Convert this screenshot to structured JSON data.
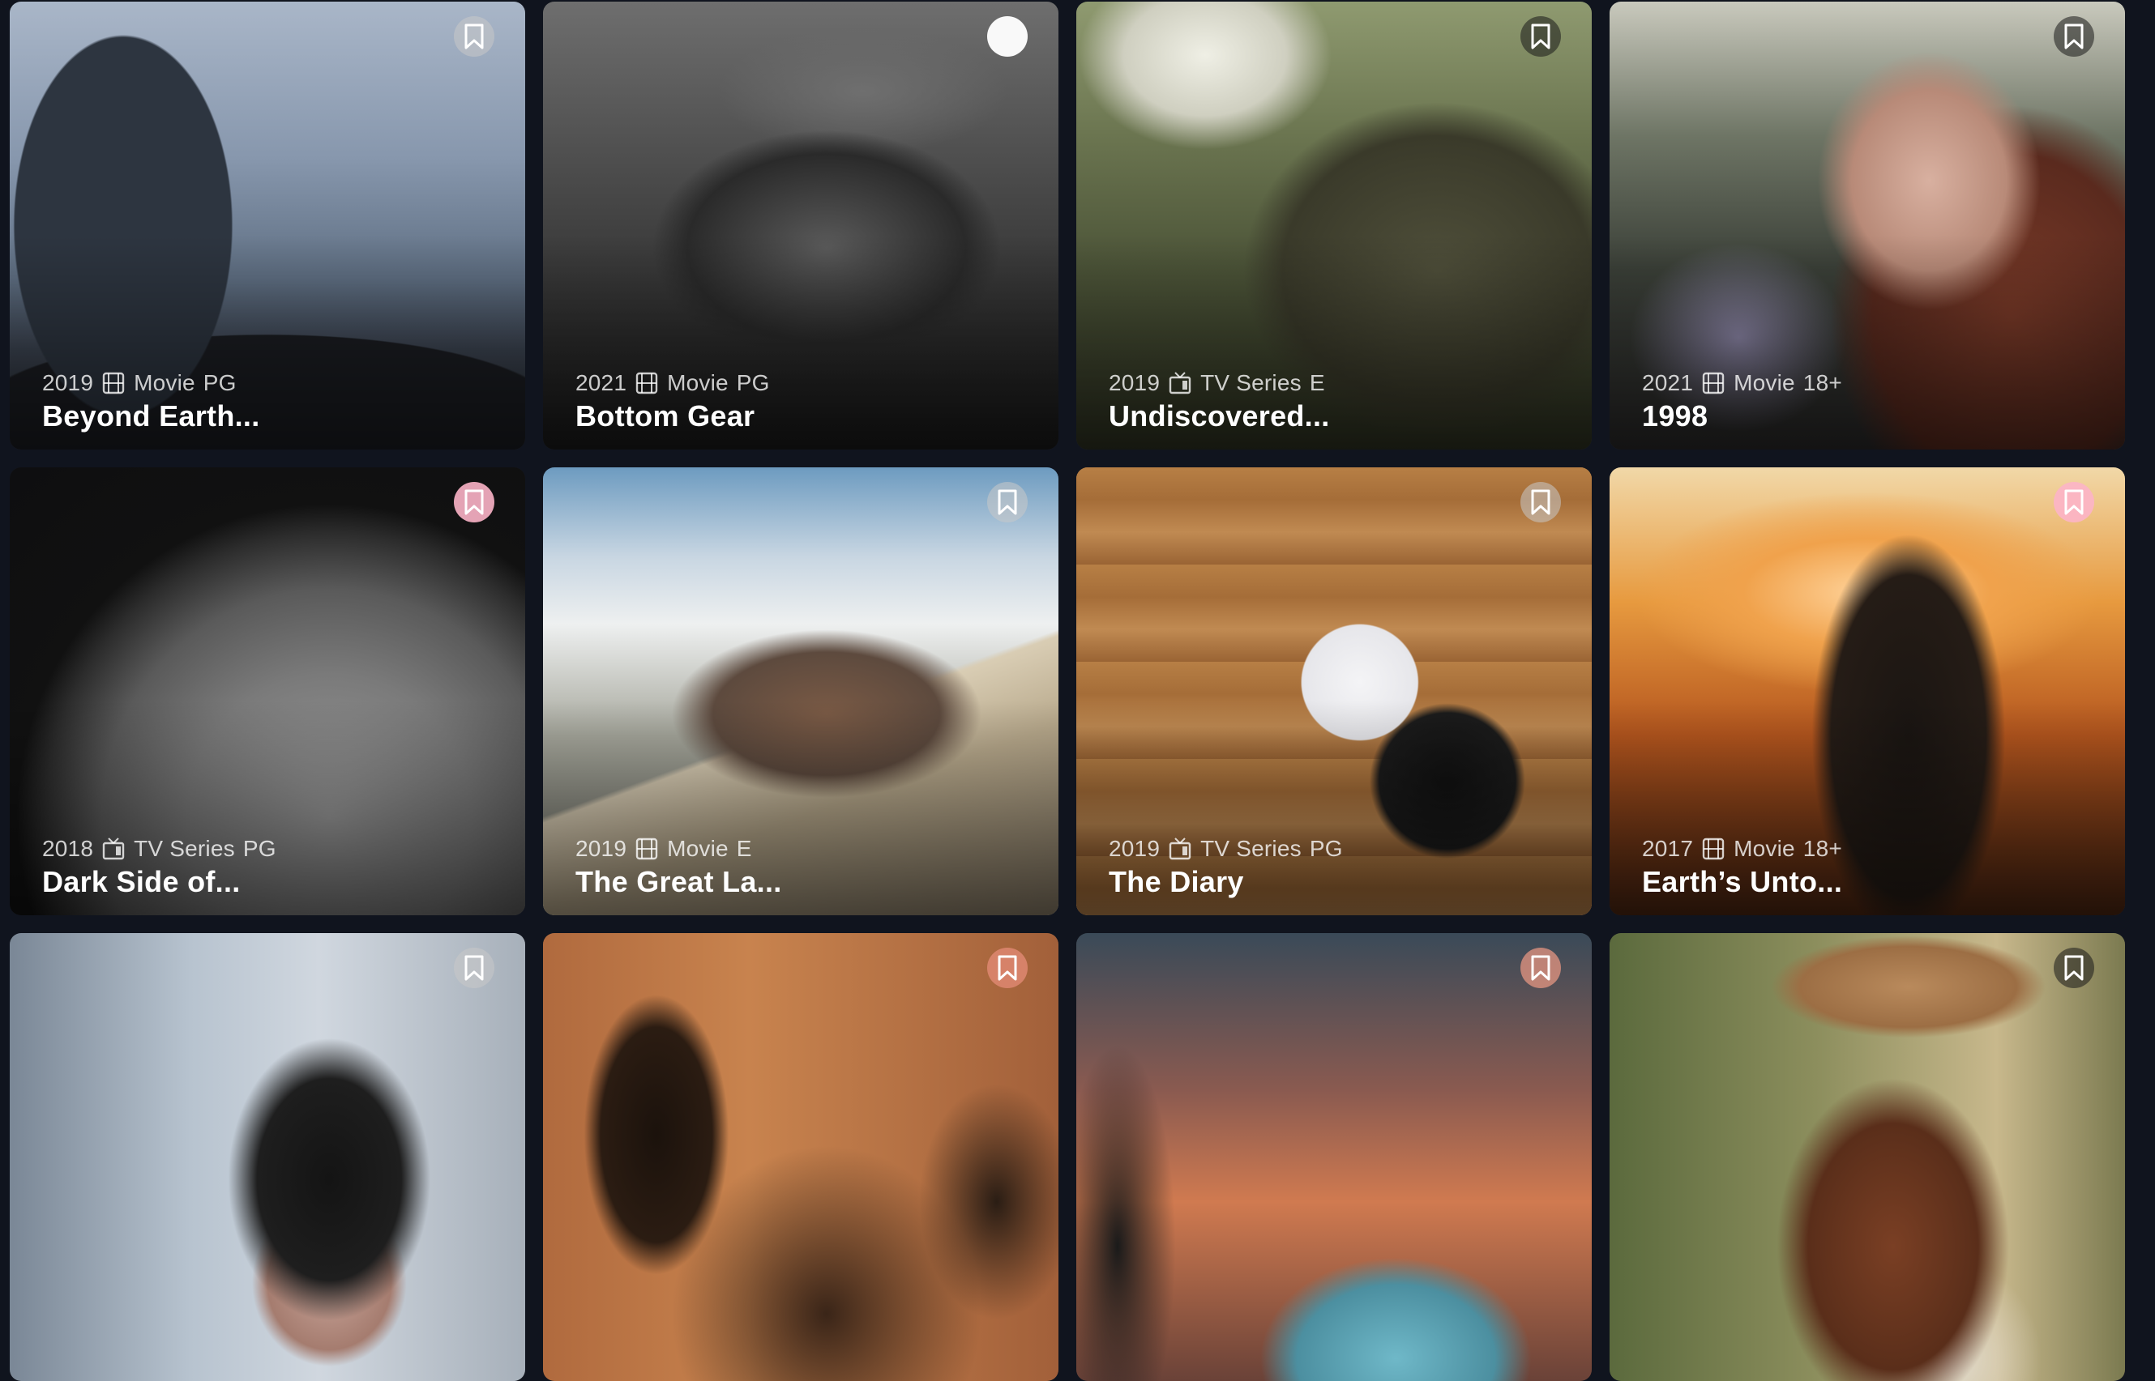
{
  "cards": [
    {
      "year": "2019",
      "category": "Movie",
      "rating": "PG",
      "title": "Beyond Earth...",
      "category_icon": "film-icon",
      "bookmark_style": "light"
    },
    {
      "year": "2021",
      "category": "Movie",
      "rating": "PG",
      "title": "Bottom Gear",
      "category_icon": "film-icon",
      "bookmark_style": "solid"
    },
    {
      "year": "2019",
      "category": "TV Series",
      "rating": "E",
      "title": "Undiscovered...",
      "category_icon": "tv-icon",
      "bookmark_style": "dark"
    },
    {
      "year": "2021",
      "category": "Movie",
      "rating": "18+",
      "title": "1998",
      "category_icon": "film-icon",
      "bookmark_style": "dark"
    },
    {
      "year": "2018",
      "category": "TV Series",
      "rating": "PG",
      "title": "Dark Side of...",
      "category_icon": "tv-icon",
      "bookmark_style": "pink"
    },
    {
      "year": "2019",
      "category": "Movie",
      "rating": "E",
      "title": "The Great La...",
      "category_icon": "film-icon",
      "bookmark_style": "light"
    },
    {
      "year": "2019",
      "category": "TV Series",
      "rating": "PG",
      "title": "The Diary",
      "category_icon": "tv-icon",
      "bookmark_style": "light"
    },
    {
      "year": "2017",
      "category": "Movie",
      "rating": "18+",
      "title": "Earth’s Unto...",
      "category_icon": "film-icon",
      "bookmark_style": "pink"
    },
    {
      "year": "",
      "category": "",
      "rating": "",
      "title": "",
      "category_icon": "",
      "bookmark_style": "light"
    },
    {
      "year": "",
      "category": "",
      "rating": "",
      "title": "",
      "category_icon": "",
      "bookmark_style": "pink"
    },
    {
      "year": "",
      "category": "",
      "rating": "",
      "title": "",
      "category_icon": "",
      "bookmark_style": "pink"
    },
    {
      "year": "",
      "category": "",
      "rating": "",
      "title": "",
      "category_icon": "",
      "bookmark_style": "light"
    }
  ],
  "colors": {
    "page_bg": "#10141e",
    "title_text": "#ffffff",
    "meta_text": "rgba(255,255,255,0.78)",
    "bookmark_pink": "#fcb4c8"
  }
}
